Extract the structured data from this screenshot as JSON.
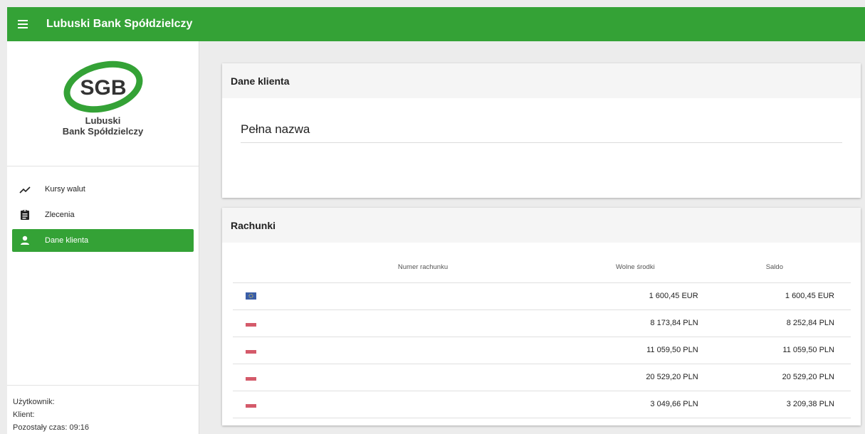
{
  "app": {
    "title": "Lubuski Bank Spółdzielczy"
  },
  "brand": {
    "logo_text": "SGB",
    "name_line1": "Lubuski",
    "name_line2": "Bank Spółdzielczy",
    "accent_color": "#34a236"
  },
  "nav": {
    "items": [
      {
        "label": "Kursy walut",
        "icon": "trending-up-icon",
        "active": false
      },
      {
        "label": "Zlecenia",
        "icon": "clipboard-icon",
        "active": false
      },
      {
        "label": "Dane klienta",
        "icon": "person-icon",
        "active": true
      }
    ]
  },
  "user": {
    "user_label": "Użytkownik:",
    "client_label": "Klient:",
    "time_label": "Pozostały czas:",
    "time_value": "09:16"
  },
  "client_card": {
    "title": "Dane klienta",
    "full_name_label": "Pełna nazwa"
  },
  "accounts_card": {
    "title": "Rachunki",
    "columns": [
      "Numer rachunku",
      "Wolne środki",
      "Saldo"
    ],
    "rows": [
      {
        "flag": "eu-flag-icon",
        "number": "",
        "available": "1 600,45 EUR",
        "balance": "1 600,45 EUR"
      },
      {
        "flag": "pl-flag-icon",
        "number": "",
        "available": "8 173,84 PLN",
        "balance": "8 252,84 PLN"
      },
      {
        "flag": "pl-flag-icon",
        "number": "",
        "available": "11 059,50 PLN",
        "balance": "11 059,50 PLN"
      },
      {
        "flag": "pl-flag-icon",
        "number": "",
        "available": "20 529,20 PLN",
        "balance": "20 529,20 PLN"
      },
      {
        "flag": "pl-flag-icon",
        "number": "",
        "available": "3 049,66 PLN",
        "balance": "3 209,38 PLN"
      }
    ]
  }
}
